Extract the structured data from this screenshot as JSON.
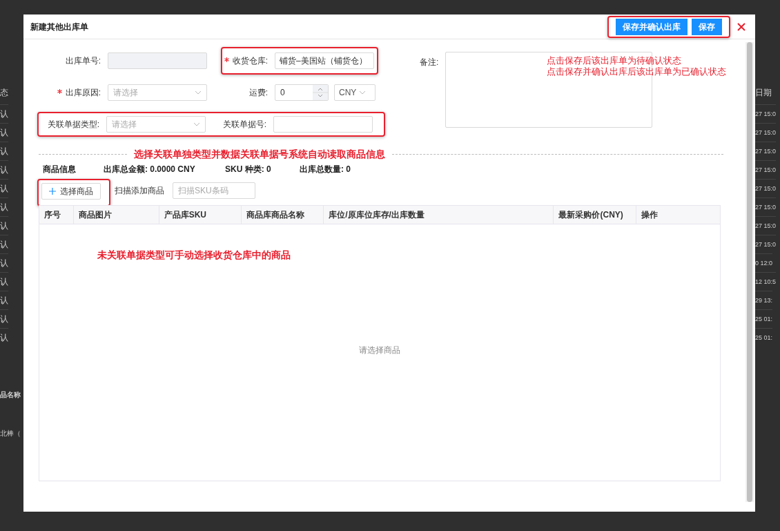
{
  "background": {
    "left_header": "态",
    "left_cells": [
      "认",
      "认",
      "认",
      "认",
      "认",
      "认",
      "认",
      "认",
      "认",
      "认",
      "认",
      "认",
      "认"
    ],
    "left_lower": [
      "品名称",
      "北棒（"
    ],
    "right_header": "日期",
    "right_cells": [
      "27 15:0",
      "27 15:0",
      "27 15:0",
      "27 15:0",
      "27 15:0",
      "27 15:0",
      "27 15:0",
      "27 15:0",
      "0 12:0",
      "12 10:5",
      "29 13:",
      "25 01:",
      "25 01:"
    ]
  },
  "dialog": {
    "title": "新建其他出库单",
    "buttons": [
      {
        "label": "保存并确认出库"
      },
      {
        "label": "保存"
      }
    ],
    "form": {
      "order_no": {
        "label": "出库单号:",
        "disabled": true
      },
      "warehouse": {
        "label": "收货仓库:",
        "required": true,
        "value": "铺货–美国站（铺货仓）"
      },
      "remark": {
        "label": "备注:"
      },
      "reason": {
        "label": "出库原因:",
        "required": true,
        "placeholder": "请选择"
      },
      "freight": {
        "label": "运费:",
        "value": "0",
        "currency": "CNY"
      },
      "link_type": {
        "label": "关联单据类型:",
        "placeholder": "请选择"
      },
      "link_no": {
        "label": "关联单据号:"
      }
    },
    "notes": {
      "save": [
        "点击保存后该出库单为待确认状态",
        "点击保存并确认出库后该出库单为已确认状态"
      ],
      "link": "选择关联单独类型并数据关联单据号系统自动读取商品信息",
      "manual": "未关联单据类型可手动选择收货仓库中的商品"
    },
    "goods": {
      "title": "商品信息",
      "summary": [
        "出库总金额: 0.0000 CNY",
        "SKU 种类: 0",
        "出库总数量: 0"
      ],
      "select_button": "选择商品",
      "scan_label": "扫描添加商品",
      "scan_placeholder": "扫描SKU条码",
      "columns": [
        "序号",
        "商品图片",
        "产品库SKU",
        "商品库商品名称",
        "库位/原库位库存/出库数量",
        "最新采购价(CNY)",
        "操作"
      ],
      "empty": "请选择商品"
    }
  }
}
